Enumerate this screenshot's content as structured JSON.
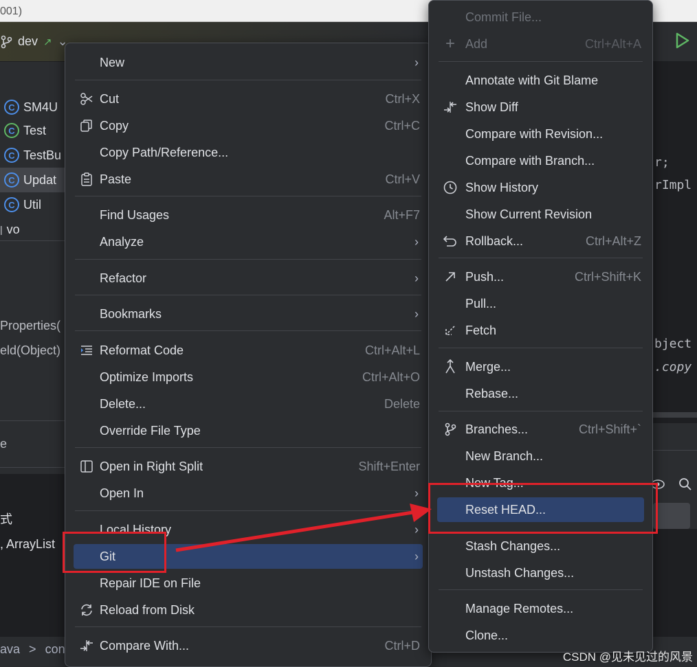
{
  "window": {
    "title_fragment": "001)"
  },
  "toolbar": {
    "branch": "dev",
    "branch_arrow": "↗",
    "branch_chevron": "⌄"
  },
  "project_tree": [
    {
      "label": "SM4U"
    },
    {
      "label": "Test"
    },
    {
      "label": "TestBu"
    },
    {
      "label": "Updat"
    },
    {
      "label": "Util"
    },
    {
      "label": "vo"
    }
  ],
  "bg_text": {
    "properties": "Properties(",
    "field_object": "eld(Object)",
    "e": "e",
    "shi": "式",
    "arraylist": ", ArrayList",
    "breadcrumb_java": "ava",
    "breadcrumb_sep": ">",
    "breadcrumb_com": "con"
  },
  "editor_code": {
    "line1": "r;",
    "line2": "rImpl",
    "line3": "bject",
    "line4": ".copy"
  },
  "context_menu": {
    "items": [
      {
        "label": "New",
        "shortcut": "",
        "submenu": true,
        "icon": ""
      },
      {
        "label": "Cut",
        "shortcut": "Ctrl+X",
        "submenu": false,
        "icon": "scissors-icon"
      },
      {
        "label": "Copy",
        "shortcut": "Ctrl+C",
        "submenu": false,
        "icon": "copy-icon"
      },
      {
        "label": "Copy Path/Reference...",
        "shortcut": "",
        "submenu": false,
        "icon": ""
      },
      {
        "label": "Paste",
        "shortcut": "Ctrl+V",
        "submenu": false,
        "icon": "paste-icon"
      },
      {
        "label": "Find Usages",
        "shortcut": "Alt+F7",
        "submenu": false,
        "icon": ""
      },
      {
        "label": "Analyze",
        "shortcut": "",
        "submenu": true,
        "icon": ""
      },
      {
        "label": "Refactor",
        "shortcut": "",
        "submenu": true,
        "icon": ""
      },
      {
        "label": "Bookmarks",
        "shortcut": "",
        "submenu": true,
        "icon": ""
      },
      {
        "label": "Reformat Code",
        "shortcut": "Ctrl+Alt+L",
        "submenu": false,
        "icon": "reformat-icon"
      },
      {
        "label": "Optimize Imports",
        "shortcut": "Ctrl+Alt+O",
        "submenu": false,
        "icon": ""
      },
      {
        "label": "Delete...",
        "shortcut": "Delete",
        "submenu": false,
        "icon": ""
      },
      {
        "label": "Override File Type",
        "shortcut": "",
        "submenu": false,
        "icon": ""
      },
      {
        "label": "Open in Right Split",
        "shortcut": "Shift+Enter",
        "submenu": false,
        "icon": "split-icon"
      },
      {
        "label": "Open In",
        "shortcut": "",
        "submenu": true,
        "icon": ""
      },
      {
        "label": "Local History",
        "shortcut": "",
        "submenu": true,
        "icon": ""
      },
      {
        "label": "Git",
        "shortcut": "",
        "submenu": true,
        "icon": "",
        "selected": true
      },
      {
        "label": "Repair IDE on File",
        "shortcut": "",
        "submenu": false,
        "icon": ""
      },
      {
        "label": "Reload from Disk",
        "shortcut": "",
        "submenu": false,
        "icon": "reload-icon"
      },
      {
        "label": "Compare With...",
        "shortcut": "Ctrl+D",
        "submenu": false,
        "icon": "compare-icon"
      }
    ]
  },
  "git_menu": {
    "items": [
      {
        "label": "Commit File...",
        "shortcut": "",
        "disabled": true,
        "icon": ""
      },
      {
        "label": "Add",
        "shortcut": "Ctrl+Alt+A",
        "disabled": true,
        "icon": "plus-icon"
      },
      {
        "label": "Annotate with Git Blame",
        "shortcut": "",
        "icon": ""
      },
      {
        "label": "Show Diff",
        "shortcut": "",
        "icon": "diff-icon"
      },
      {
        "label": "Compare with Revision...",
        "shortcut": "",
        "icon": ""
      },
      {
        "label": "Compare with Branch...",
        "shortcut": "",
        "icon": ""
      },
      {
        "label": "Show History",
        "shortcut": "",
        "icon": "clock-icon"
      },
      {
        "label": "Show Current Revision",
        "shortcut": "",
        "icon": ""
      },
      {
        "label": "Rollback...",
        "shortcut": "Ctrl+Alt+Z",
        "icon": "rollback-icon"
      },
      {
        "label": "Push...",
        "shortcut": "Ctrl+Shift+K",
        "icon": "push-icon"
      },
      {
        "label": "Pull...",
        "shortcut": "",
        "icon": ""
      },
      {
        "label": "Fetch",
        "shortcut": "",
        "icon": "fetch-icon"
      },
      {
        "label": "Merge...",
        "shortcut": "",
        "icon": "merge-icon"
      },
      {
        "label": "Rebase...",
        "shortcut": "",
        "icon": ""
      },
      {
        "label": "Branches...",
        "shortcut": "Ctrl+Shift+`",
        "icon": "branch-icon"
      },
      {
        "label": "New Branch...",
        "shortcut": "",
        "icon": ""
      },
      {
        "label": "New Tag...",
        "shortcut": "",
        "icon": ""
      },
      {
        "label": "Reset HEAD...",
        "shortcut": "",
        "icon": "",
        "selected": true
      },
      {
        "label": "Stash Changes...",
        "shortcut": "",
        "icon": ""
      },
      {
        "label": "Unstash Changes...",
        "shortcut": "",
        "icon": ""
      },
      {
        "label": "Manage Remotes...",
        "shortcut": "",
        "icon": ""
      },
      {
        "label": "Clone...",
        "shortcut": "",
        "icon": ""
      }
    ]
  },
  "watermark": "CSDN @见未见过的风景",
  "colors": {
    "highlight_box": "#e0212a",
    "selected_item": "#2e436e",
    "menu_bg": "#2b2d30"
  }
}
